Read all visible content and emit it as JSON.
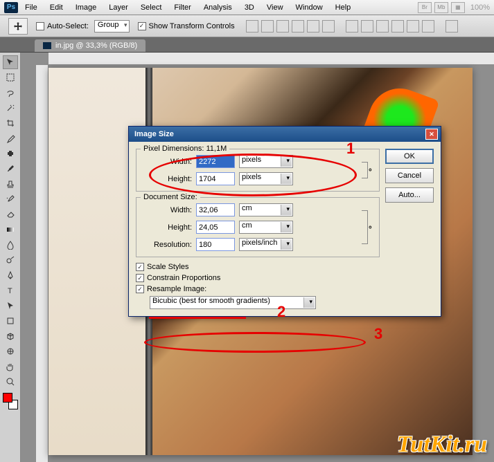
{
  "menubar": {
    "items": [
      "File",
      "Edit",
      "Image",
      "Layer",
      "Select",
      "Filter",
      "Analysis",
      "3D",
      "View",
      "Window",
      "Help"
    ],
    "right_icons": [
      "Br",
      "Mb",
      "▦",
      "100%"
    ]
  },
  "ps_logo": "Ps",
  "optbar": {
    "auto_select": "Auto-Select:",
    "group": "Group",
    "show_transform": "Show Transform Controls"
  },
  "tab": {
    "file_name": "in.jpg @ 33,3% (RGB/8)"
  },
  "dialog": {
    "title": "Image Size",
    "buttons": {
      "ok": "OK",
      "cancel": "Cancel",
      "auto": "Auto..."
    },
    "pixel": {
      "legend": "Pixel Dimensions:  11,1M",
      "width_l": "Width:",
      "width_v": "2272",
      "width_u": "pixels",
      "height_l": "Height:",
      "height_v": "1704",
      "height_u": "pixels"
    },
    "doc": {
      "legend": "Document Size:",
      "width_l": "Width:",
      "width_v": "32,06",
      "width_u": "cm",
      "height_l": "Height:",
      "height_v": "24,05",
      "height_u": "cm",
      "res_l": "Resolution:",
      "res_v": "180",
      "res_u": "pixels/inch"
    },
    "checks": {
      "scale": "Scale Styles",
      "constrain": "Constrain Proportions",
      "resample": "Resample Image:"
    },
    "resample_method": "Bicubic (best for smooth gradients)"
  },
  "annotations": {
    "n1": "1",
    "n2": "2",
    "n3": "3"
  },
  "watermark": "TutKit.ru"
}
